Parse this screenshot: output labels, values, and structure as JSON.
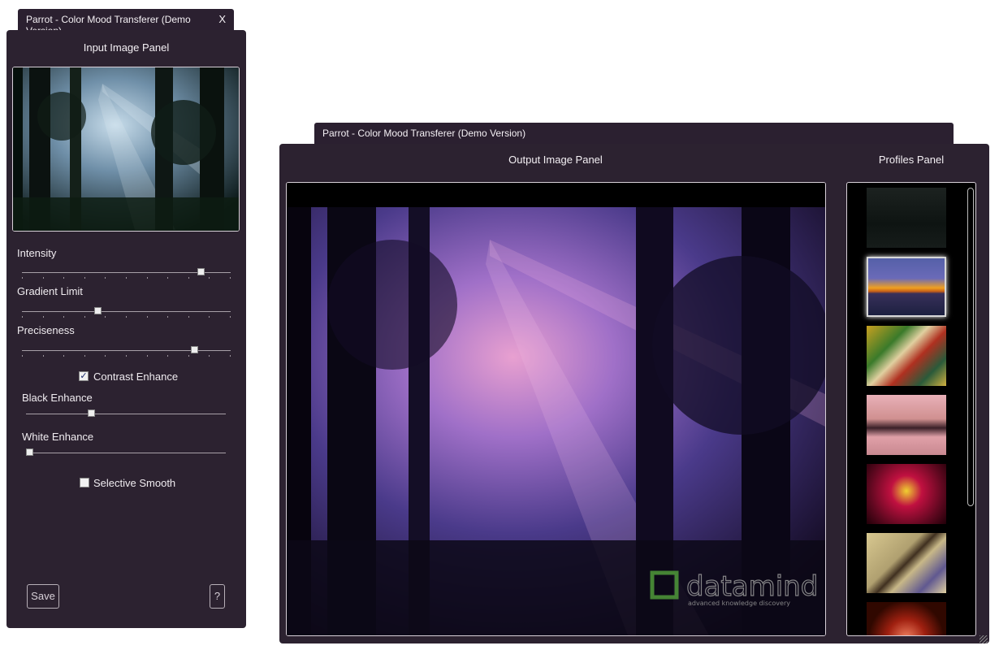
{
  "window1": {
    "title": "Parrot - Color Mood Transferer (Demo Version)",
    "close_label": "X",
    "panel_title": "Input Image Panel",
    "sliders": [
      {
        "label": "Intensity",
        "value": 0.87
      },
      {
        "label": "Gradient Limit",
        "value": 0.36
      },
      {
        "label": "Preciseness",
        "value": 0.84
      }
    ],
    "contrast_enhance": {
      "label": "Contrast Enhance",
      "checked": true
    },
    "black_enhance": {
      "label": "Black Enhance",
      "value": 0.32
    },
    "white_enhance": {
      "label": "White Enhance",
      "value": 0.0
    },
    "selective_smooth": {
      "label": "Selective Smooth",
      "checked": false
    },
    "save_label": "Save",
    "help_label": "?"
  },
  "window2": {
    "title": "Parrot - Color Mood Transferer (Demo Version)",
    "output_title": "Output Image Panel",
    "profiles_title": "Profiles Panel",
    "watermark_word": "datamind",
    "watermark_tagline": "advanced knowledge discovery",
    "profiles": [
      {
        "name": "dark-forest-profile",
        "selected": false
      },
      {
        "name": "sunset-lake-profile",
        "selected": true
      },
      {
        "name": "abstract-art-profile",
        "selected": false
      },
      {
        "name": "palm-sunset-profile",
        "selected": false
      },
      {
        "name": "red-tree-profile",
        "selected": false
      },
      {
        "name": "kandinsky-profile",
        "selected": false
      },
      {
        "name": "red-window-profile",
        "selected": false
      }
    ]
  },
  "colors": {
    "panel_bg": "#2c2230",
    "tab_bg": "#2b2030",
    "text": "#f4f0f4"
  }
}
